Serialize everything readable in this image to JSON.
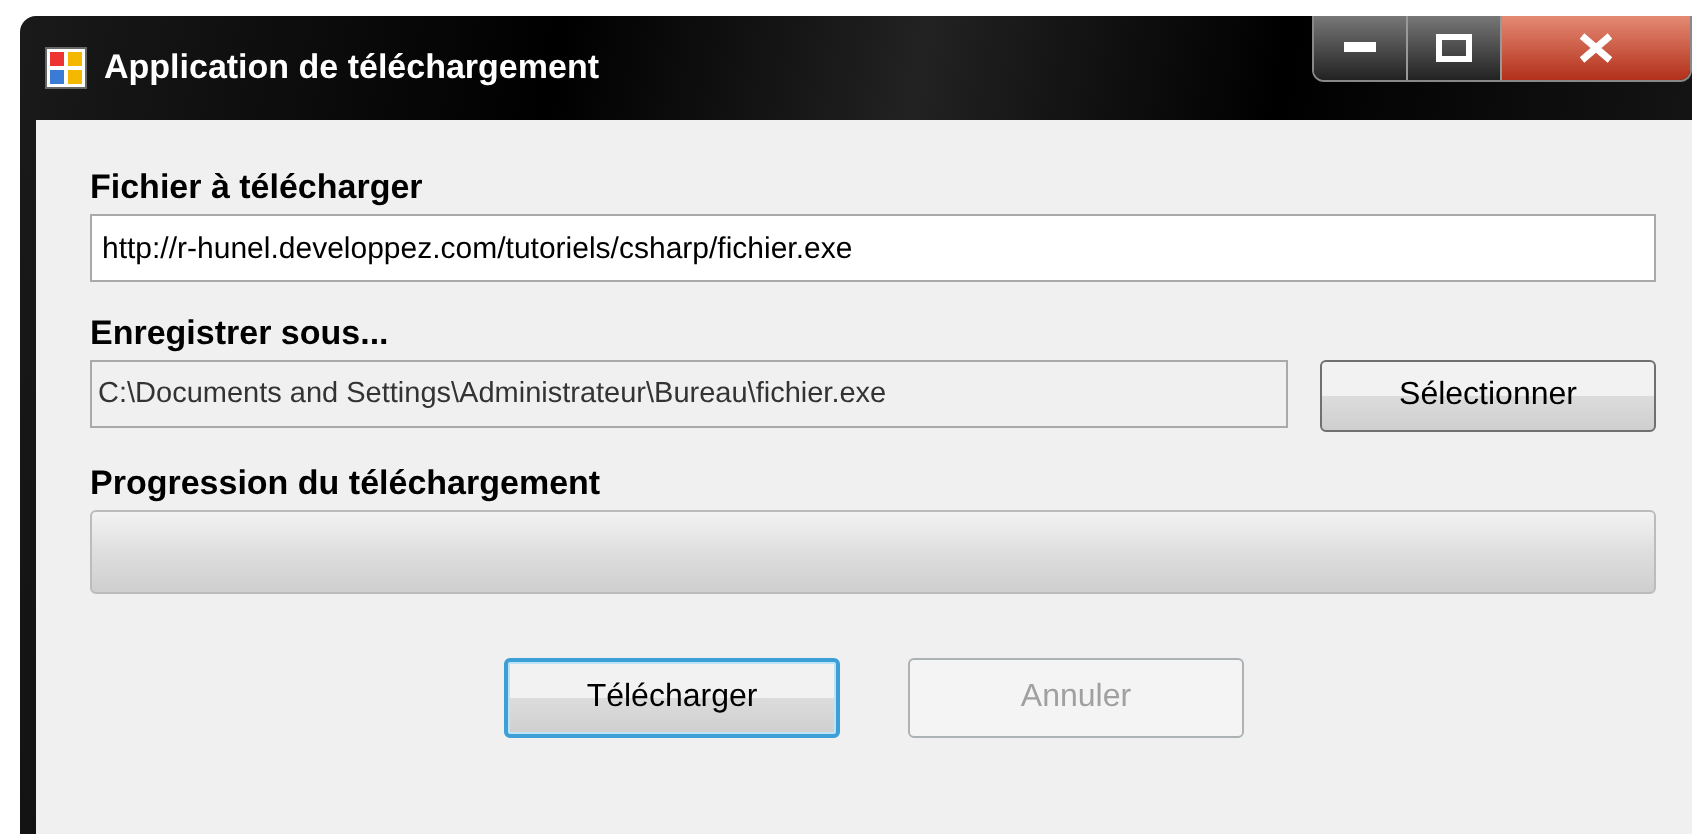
{
  "window": {
    "title": "Application de téléchargement"
  },
  "fields": [
    {
      "label": "Fichier à télécharger",
      "value": "http://r-hunel.developpez.com/tutoriels/csharp/fichier.exe",
      "readonly": false
    },
    {
      "label": "Enregistrer sous...",
      "value": "C:\\Documents and Settings\\Administrateur\\Bureau\\fichier.exe",
      "readonly": true,
      "button": "Sélectionner"
    }
  ],
  "progress": {
    "label": "Progression du téléchargement",
    "level": 0
  },
  "buttons": [
    {
      "label": "Télécharger",
      "disabled": false,
      "default": true
    },
    {
      "label": "Annuler",
      "disabled": true,
      "default": false
    }
  ]
}
